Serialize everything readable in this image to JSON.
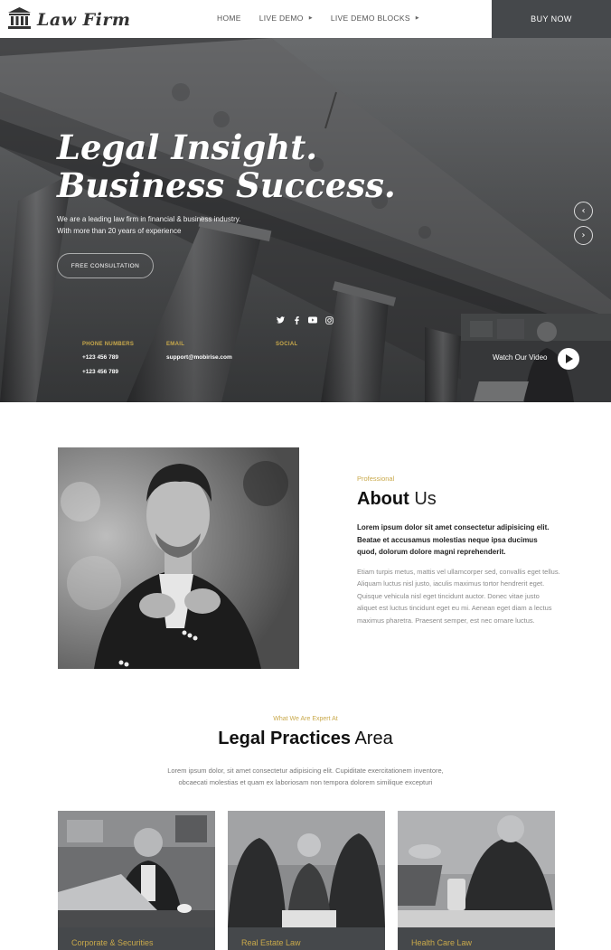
{
  "brand": {
    "name": "Law Firm",
    "icon": "courthouse-icon"
  },
  "nav": {
    "items": [
      {
        "label": "HOME",
        "has_caret": false
      },
      {
        "label": "LIVE DEMO",
        "has_caret": true
      },
      {
        "label": "LIVE DEMO BLOCKS",
        "has_caret": true
      }
    ],
    "buy_label": "BUY NOW"
  },
  "hero": {
    "title_line1": "Legal Insight.",
    "title_line2": "Business Success.",
    "subtitle_line1": "We are a leading law firm in financial & business industry.",
    "subtitle_line2": "With more than 20 years of experience",
    "cta_label": "FREE CONSULTATION",
    "prev_icon": "chevron-left-icon",
    "next_icon": "chevron-right-icon",
    "phone_label": "PHONE NUMBERS",
    "phone_1": "+123 456 789",
    "phone_2": "+123 456 789",
    "email_label": "EMAIL",
    "email": "support@mobirise.com",
    "social_label": "SOCIAL",
    "social_icons": [
      "twitter-icon",
      "facebook-icon",
      "youtube-icon",
      "instagram-icon"
    ],
    "video_label": "Watch Our Video"
  },
  "about": {
    "kicker": "Professional",
    "title_bold": "About",
    "title_light": " Us",
    "lead": "Lorem ipsum dolor sit amet consectetur adipisicing elit. Beatae et accusamus molestias neque ipsa ducimus quod, dolorum dolore magni reprehenderit.",
    "body": "Etiam turpis metus, mattis vel ullamcorper sed, convallis eget tellus. Aliquam luctus nisl justo, iaculis maximus tortor hendrerit eget. Quisque vehicula nisl eget tincidunt auctor. Donec vitae justo aliquet est luctus tincidunt eget eu mi. Aenean eget diam a lectus maximus pharetra. Praesent semper, est nec ornare luctus."
  },
  "practices": {
    "kicker": "What We Are Expert At",
    "title_bold": "Legal Practices",
    "title_light": " Area",
    "desc_line1": "Lorem ipsum dolor, sit amet consectetur adipisicing elit. Cupiditate exercitationem inventore,",
    "desc_line2": "obcaecati molestias et quam ex laboriosam non tempora dolorem similique excepturi",
    "cards": [
      {
        "label": "Corporate & Securities"
      },
      {
        "label": "Real Estate Law"
      },
      {
        "label": "Health Care Law"
      }
    ]
  },
  "colors": {
    "accent": "#c9a94b",
    "dark": "#45484b"
  }
}
